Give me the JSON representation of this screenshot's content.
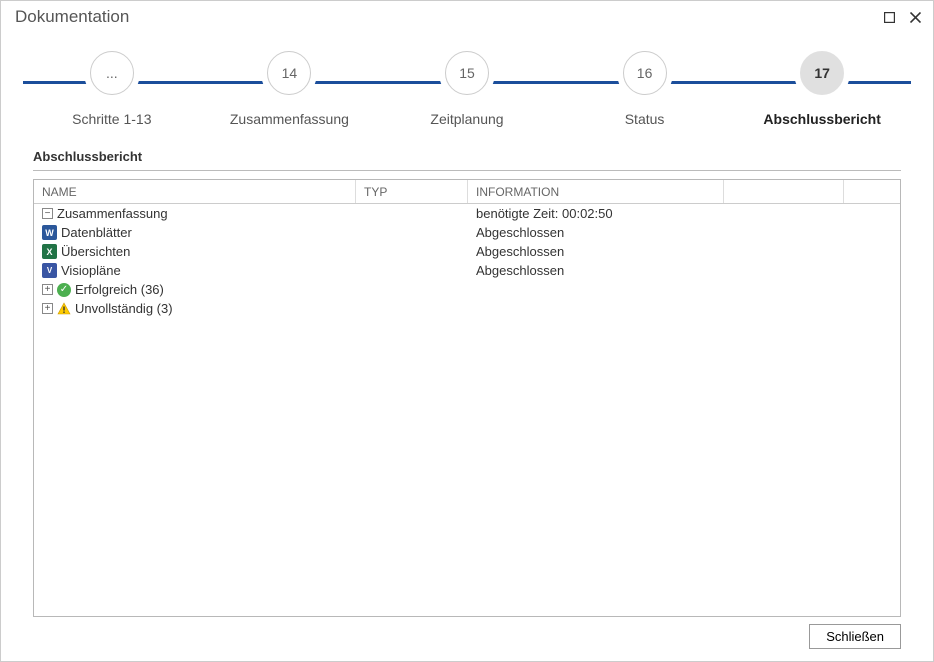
{
  "window": {
    "title": "Dokumentation"
  },
  "wizard": {
    "steps": [
      {
        "num": "...",
        "label": "Schritte 1-13",
        "active": false
      },
      {
        "num": "14",
        "label": "Zusammenfassung",
        "active": false
      },
      {
        "num": "15",
        "label": "Zeitplanung",
        "active": false
      },
      {
        "num": "16",
        "label": "Status",
        "active": false
      },
      {
        "num": "17",
        "label": "Abschlussbericht",
        "active": true
      }
    ]
  },
  "section": {
    "title": "Abschlussbericht"
  },
  "grid": {
    "headers": {
      "name": "NAME",
      "typ": "TYP",
      "info": "INFORMATION"
    },
    "rows": [
      {
        "indent": 1,
        "toggle": "−",
        "icon": null,
        "name": "Zusammenfassung",
        "info": "benötigte Zeit: 00:02:50"
      },
      {
        "indent": 2,
        "toggle": null,
        "icon": "word",
        "iconText": "W",
        "name": "Datenblätter",
        "info": "Abgeschlossen"
      },
      {
        "indent": 2,
        "toggle": null,
        "icon": "excel",
        "iconText": "X",
        "name": "Übersichten",
        "info": "Abgeschlossen"
      },
      {
        "indent": 2,
        "toggle": null,
        "icon": "visio",
        "iconText": "V",
        "name": "Visiopläne",
        "info": "Abgeschlossen"
      },
      {
        "indent": 1,
        "toggle": "+",
        "icon": "success",
        "iconText": "✓",
        "name": "Erfolgreich (36)",
        "info": ""
      },
      {
        "indent": 1,
        "toggle": "+",
        "icon": "warning",
        "iconText": "⚠",
        "name": "Unvollständig (3)",
        "info": ""
      }
    ]
  },
  "footer": {
    "close": "Schließen"
  }
}
